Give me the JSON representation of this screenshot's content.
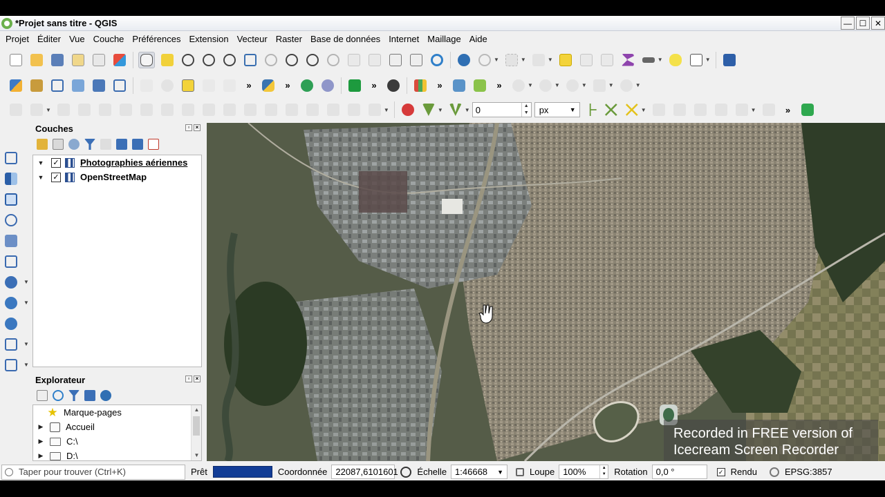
{
  "window": {
    "title": "*Projet sans titre - QGIS",
    "minimize_glyph": "—",
    "maximize_glyph": "☐",
    "close_glyph": "✕"
  },
  "menu": [
    "Projet",
    "Éditer",
    "Vue",
    "Couche",
    "Préférences",
    "Extension",
    "Vecteur",
    "Raster",
    "Base de données",
    "Internet",
    "Maillage",
    "Aide"
  ],
  "toolbar": {
    "more_glyph": "»",
    "snapping_tolerance_value": "0",
    "snapping_unit": "px"
  },
  "layers_panel": {
    "title": "Couches",
    "layers": [
      {
        "name": "Photographies aériennes",
        "checked": true,
        "active": true
      },
      {
        "name": "OpenStreetMap",
        "checked": true,
        "active": false
      }
    ]
  },
  "browser_panel": {
    "title": "Explorateur",
    "items": [
      {
        "label": "Marque-pages",
        "icon": "star-icon",
        "expandable": false
      },
      {
        "label": "Accueil",
        "icon": "home-icon",
        "expandable": true
      },
      {
        "label": "C:\\",
        "icon": "folder-icon",
        "expandable": true
      },
      {
        "label": "D:\\",
        "icon": "folder-icon",
        "expandable": true
      }
    ]
  },
  "check_glyph": "✓",
  "expand_glyph": "▶",
  "collapse_glyph": "▼",
  "statusbar": {
    "locator_placeholder": "Taper pour trouver (Ctrl+K)",
    "ready": "Prêt",
    "coordinate_label": "Coordonnée",
    "coordinate_value": "22087,6101601",
    "scale_label": "Échelle",
    "scale_value": "1:46668",
    "magnifier_label": "Loupe",
    "magnifier_value": "100%",
    "rotation_label": "Rotation",
    "rotation_value": "0,0 °",
    "render_label": "Rendu",
    "crs": "EPSG:3857"
  },
  "watermark": {
    "line1": "Recorded in FREE version of",
    "line2": "Icecream   Screen   Recorder"
  },
  "colors": {
    "progress": "#123d96",
    "map_base": "#5f6459"
  }
}
